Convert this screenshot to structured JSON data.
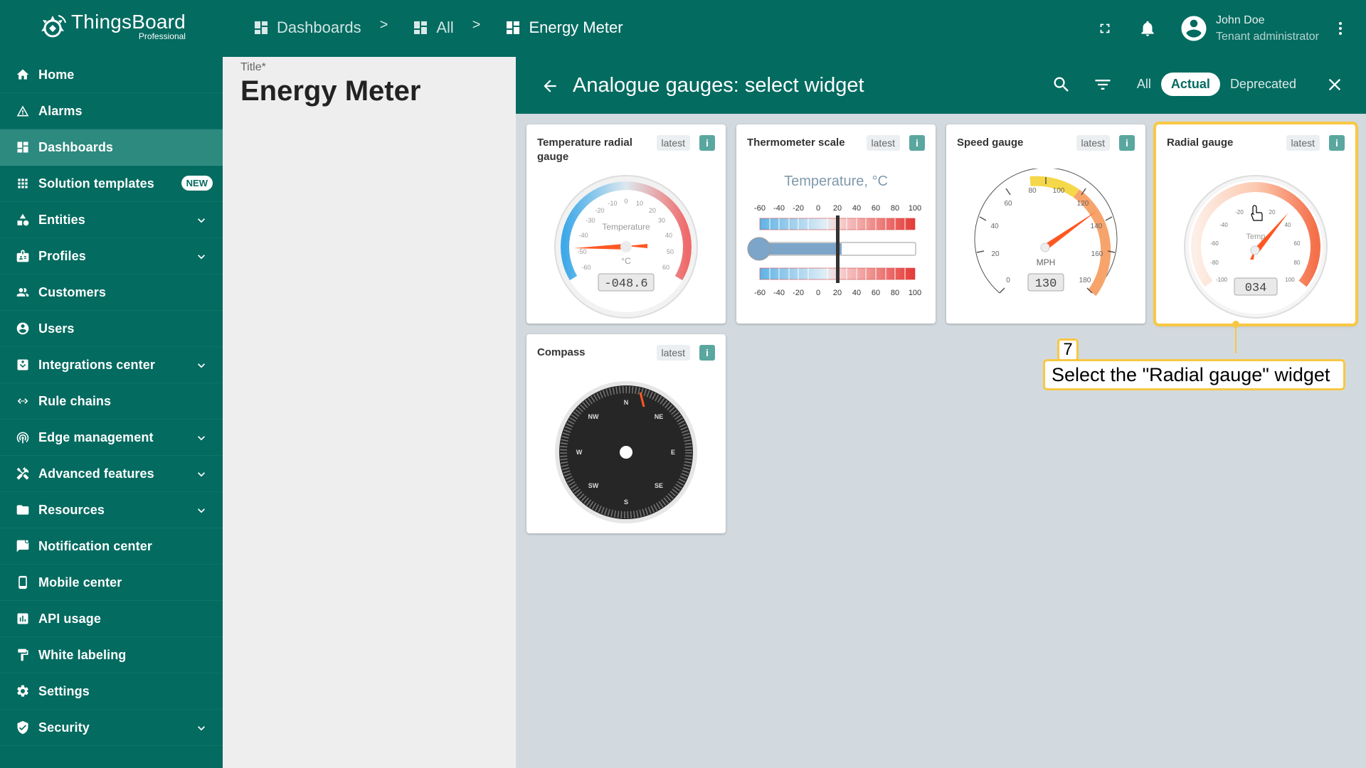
{
  "app": {
    "brand": "ThingsBoard",
    "edition": "Professional"
  },
  "breadcrumb": [
    {
      "label": "Dashboards"
    },
    {
      "label": "All"
    },
    {
      "label": "Energy Meter"
    }
  ],
  "breadcrumb_sep": ">",
  "user": {
    "name": "John Doe",
    "role": "Tenant administrator"
  },
  "sidebar": {
    "items": [
      {
        "label": "Home",
        "icon": "home-icon"
      },
      {
        "label": "Alarms",
        "icon": "alarm-icon"
      },
      {
        "label": "Dashboards",
        "icon": "dashboards-icon",
        "active": true
      },
      {
        "label": "Solution templates",
        "icon": "apps-icon",
        "badge": "NEW"
      },
      {
        "label": "Entities",
        "icon": "entities-icon",
        "expandable": true
      },
      {
        "label": "Profiles",
        "icon": "profiles-icon",
        "expandable": true
      },
      {
        "label": "Customers",
        "icon": "customers-icon"
      },
      {
        "label": "Users",
        "icon": "user-icon"
      },
      {
        "label": "Integrations center",
        "icon": "integrations-icon",
        "expandable": true
      },
      {
        "label": "Rule chains",
        "icon": "rule-chains-icon"
      },
      {
        "label": "Edge management",
        "icon": "edge-icon",
        "expandable": true
      },
      {
        "label": "Advanced features",
        "icon": "tools-icon",
        "expandable": true
      },
      {
        "label": "Resources",
        "icon": "folder-icon",
        "expandable": true
      },
      {
        "label": "Notification center",
        "icon": "notification-icon"
      },
      {
        "label": "Mobile center",
        "icon": "mobile-icon"
      },
      {
        "label": "API usage",
        "icon": "chart-icon"
      },
      {
        "label": "White labeling",
        "icon": "paint-roller-icon"
      },
      {
        "label": "Settings",
        "icon": "gear-icon"
      },
      {
        "label": "Security",
        "icon": "shield-icon",
        "expandable": true
      }
    ]
  },
  "dashboard_form": {
    "title_label": "Title*",
    "title_value": "Energy Meter"
  },
  "widget_selector": {
    "title": "Analogue gauges: select widget",
    "filters": [
      "All",
      "Actual",
      "Deprecated"
    ],
    "active_filter": "Actual",
    "widgets": [
      {
        "title": "Temperature radial gauge",
        "tag": "latest",
        "info": "i",
        "gauge_title": "Temperature",
        "unit": "°C",
        "value_text": "-048.6",
        "ticks": [
          "-60",
          "-50",
          "-40",
          "-30",
          "-20",
          "-10",
          "0",
          "10",
          "20",
          "30",
          "40",
          "50",
          "60"
        ]
      },
      {
        "title": "Thermometer scale",
        "tag": "latest",
        "info": "i",
        "gauge_title": "Temperature, °C",
        "scale": [
          "-60",
          "-40",
          "-20",
          "0",
          "20",
          "40",
          "60",
          "80",
          "100"
        ]
      },
      {
        "title": "Speed gauge",
        "tag": "latest",
        "info": "i",
        "unit": "MPH",
        "value_text": "130",
        "ticks": [
          "0",
          "20",
          "40",
          "60",
          "80",
          "100",
          "120",
          "140",
          "160",
          "180"
        ]
      },
      {
        "title": "Radial gauge",
        "tag": "latest",
        "info": "i",
        "selected": true,
        "gauge_title": "Temp",
        "value_text": "034",
        "ticks": [
          "-100",
          "-80",
          "-60",
          "-40",
          "-20",
          "20",
          "40",
          "60",
          "80",
          "100"
        ]
      },
      {
        "title": "Compass",
        "tag": "latest",
        "info": "i",
        "directions": [
          "N",
          "NE",
          "E",
          "SE",
          "S",
          "SW",
          "W",
          "NW"
        ]
      }
    ]
  },
  "tutorial": {
    "step": "7",
    "text": "Select the \"Radial gauge\" widget"
  },
  "colors": {
    "primary": "#036b60",
    "active_nav": "#2d8a7f",
    "highlight": "#f8c744",
    "needle": "#ff5722"
  }
}
